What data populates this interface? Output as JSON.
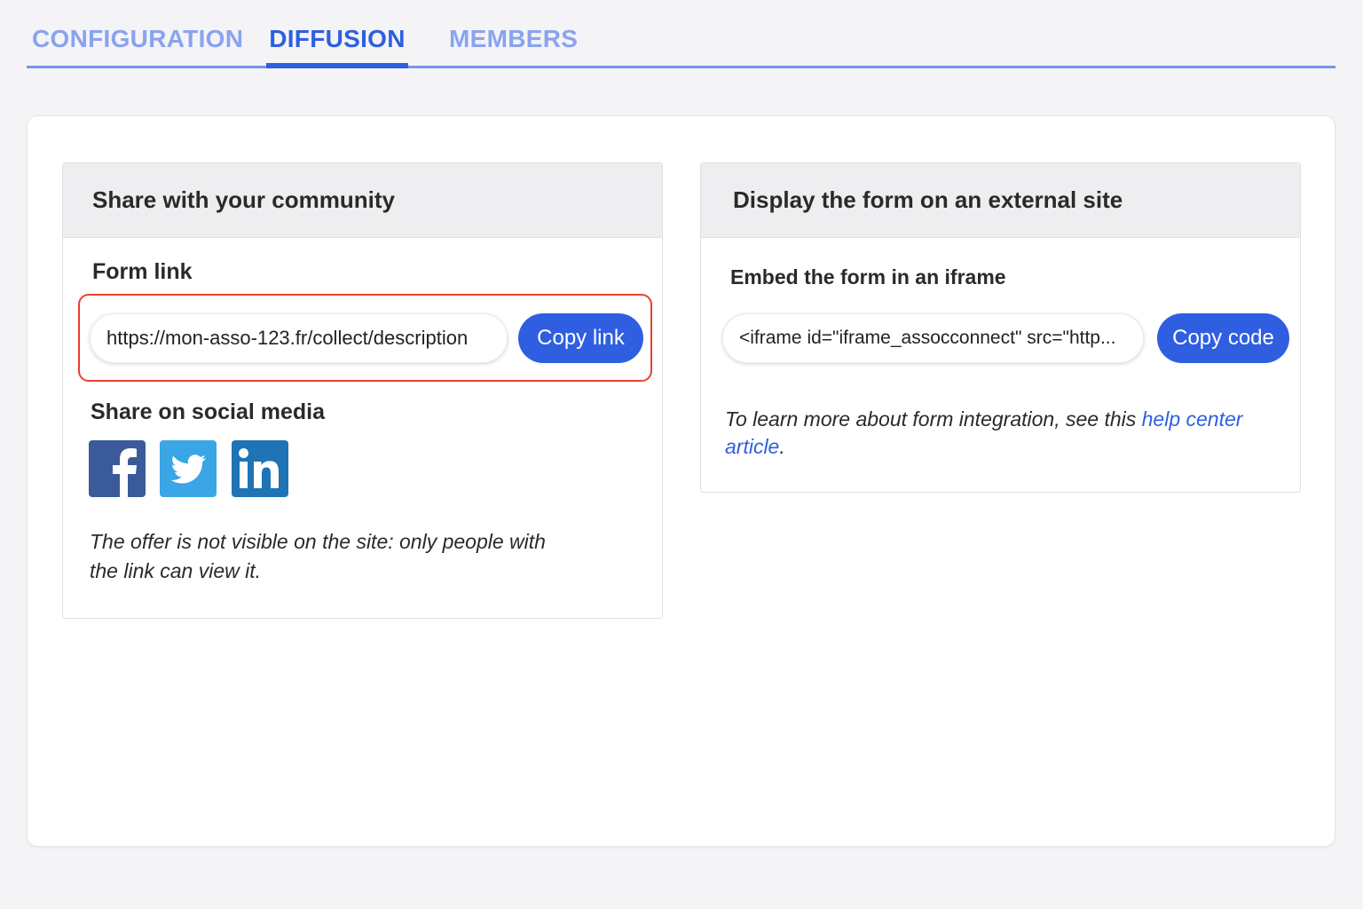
{
  "tabs": [
    {
      "label": "CONFIGURATION",
      "active": false
    },
    {
      "label": "DIFFUSION",
      "active": true
    },
    {
      "label": "MEMBERS",
      "active": false
    }
  ],
  "share": {
    "title": "Share with your community",
    "form_link_label": "Form link",
    "form_link_value": "https://mon-asso-123.fr/collect/description",
    "copy_link_label": "Copy link",
    "social_label": "Share on social media",
    "social_icons": [
      "facebook-icon",
      "twitter-icon",
      "linkedin-icon"
    ],
    "note": "The offer is not visible on the site: only people with the link can view it."
  },
  "embed": {
    "title": "Display the form on an external site",
    "iframe_label": "Embed the form in an iframe",
    "iframe_code": "<iframe id=\"iframe_assocconnect\" src=\"http...",
    "copy_code_label": "Copy code",
    "help_text": "To learn more about form integration, see this ",
    "help_link": "help center article",
    "help_suffix": "."
  },
  "colors": {
    "accent": "#2f5fe0",
    "tab_inactive": "#8aa3f0",
    "highlight": "#e8402f",
    "facebook": "#3b5a9a",
    "twitter": "#3aa6e6",
    "linkedin": "#1e74b4"
  }
}
